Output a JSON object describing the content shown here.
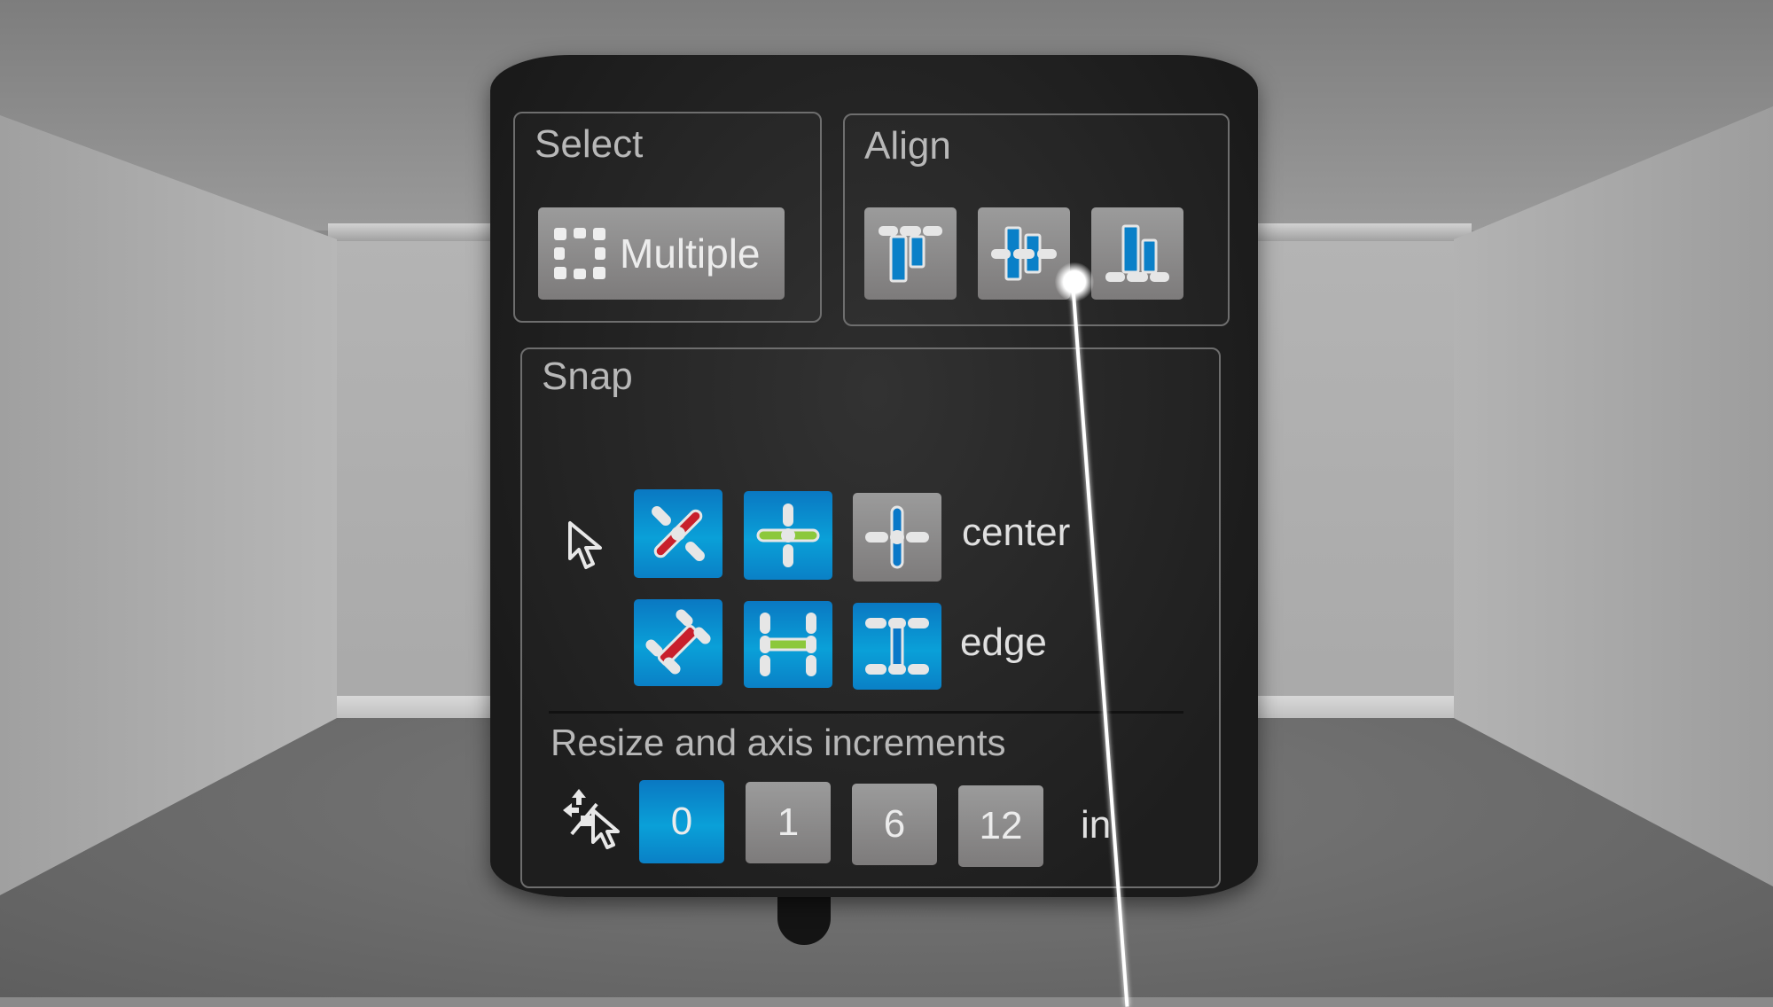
{
  "select": {
    "title": "Select",
    "multiple_label": "Multiple",
    "multiple_icon": "dashed-selection-icon"
  },
  "align": {
    "title": "Align",
    "buttons": [
      {
        "name": "align-top",
        "icon": "align-top-icon"
      },
      {
        "name": "align-center",
        "icon": "align-center-icon"
      },
      {
        "name": "align-bottom",
        "icon": "align-bottom-icon"
      }
    ]
  },
  "snap": {
    "title": "Snap",
    "rows": [
      {
        "label": "center",
        "buttons": [
          {
            "icon": "snap-center-diagonal-icon",
            "active": true
          },
          {
            "icon": "snap-center-horizontal-icon",
            "active": true
          },
          {
            "icon": "snap-center-vertical-icon",
            "active": false
          }
        ]
      },
      {
        "label": "edge",
        "buttons": [
          {
            "icon": "snap-edge-diagonal-icon",
            "active": true
          },
          {
            "icon": "snap-edge-horizontal-icon",
            "active": true
          },
          {
            "icon": "snap-edge-vertical-icon",
            "active": true
          }
        ]
      }
    ],
    "cursor_icon": "pointer-cursor-icon"
  },
  "increments": {
    "title": "Resize and axis increments",
    "icon": "no-snap-cursor-icon",
    "values": [
      "0",
      "1",
      "6",
      "12"
    ],
    "selected": "0",
    "unit": "in"
  },
  "colors": {
    "active_blue": "#0a8fd0",
    "inactive_gray": "#8c8a8a",
    "red_axis": "#c8202c",
    "green_axis": "#8cc83c",
    "blue_axis": "#0a78c8"
  }
}
